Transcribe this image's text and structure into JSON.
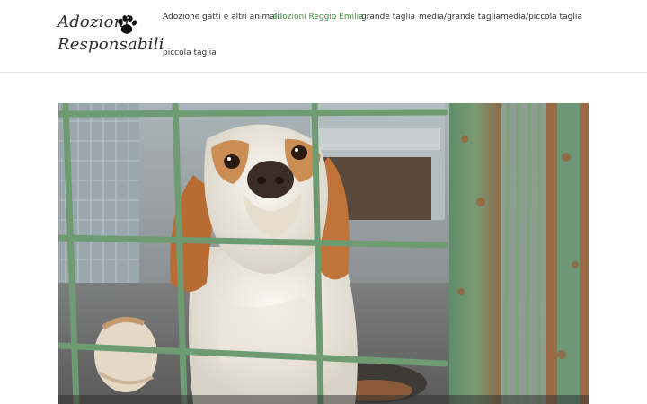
{
  "site": {
    "logo_line1": "Adozioni",
    "logo_line2": "Responsabili",
    "logo_icon": "paw-icon"
  },
  "nav": {
    "items": [
      {
        "label": "Adozione gatti e altri animali",
        "active": false
      },
      {
        "label": "adozioni Reggio Emilia",
        "active": true
      },
      {
        "label": "grande taglia",
        "active": false
      },
      {
        "label": "media/grande taglia",
        "active": false
      },
      {
        "label": "media/piccola taglia",
        "active": false
      },
      {
        "label": "piccola taglia",
        "active": false
      }
    ]
  },
  "colors": {
    "active_link": "#3f8f3a",
    "link": "#333333",
    "cage_bar": "#6f9b73"
  },
  "hero": {
    "description": "photo of a white and orange setter dog behind green cage bars"
  }
}
